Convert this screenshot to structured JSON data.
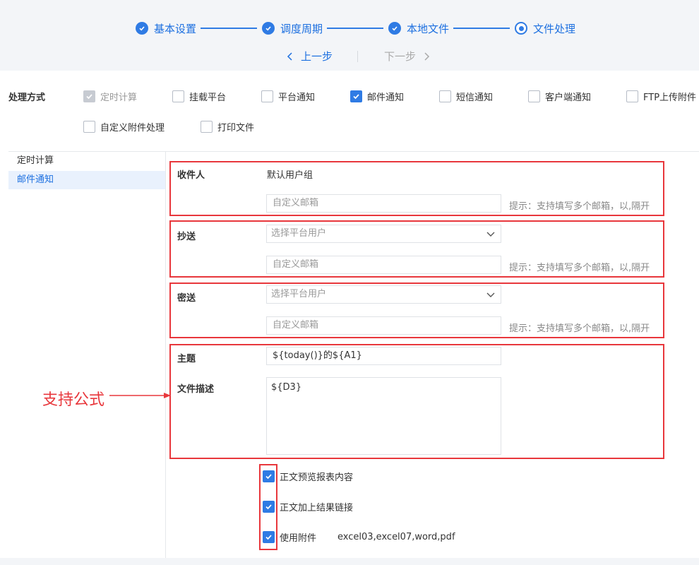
{
  "wizard": {
    "steps": [
      {
        "label": "基本设置",
        "state": "done"
      },
      {
        "label": "调度周期",
        "state": "done"
      },
      {
        "label": "本地文件",
        "state": "done"
      },
      {
        "label": "文件处理",
        "state": "current"
      }
    ],
    "prev_label": "上一步",
    "next_label": "下一步"
  },
  "method": {
    "label": "处理方式",
    "options": [
      {
        "label": "定时计算",
        "checked": true,
        "disabled": true
      },
      {
        "label": "挂载平台",
        "checked": false
      },
      {
        "label": "平台通知",
        "checked": false
      },
      {
        "label": "邮件通知",
        "checked": true
      },
      {
        "label": "短信通知",
        "checked": false
      },
      {
        "label": "客户端通知",
        "checked": false
      },
      {
        "label": "FTP上传附件",
        "checked": false
      },
      {
        "label": "自定义附件处理",
        "checked": false
      },
      {
        "label": "打印文件",
        "checked": false
      }
    ]
  },
  "sidebar": {
    "items": [
      {
        "label": "定时计算",
        "active": false
      },
      {
        "label": "邮件通知",
        "active": true
      }
    ]
  },
  "email": {
    "recipient": {
      "label": "收件人",
      "default_group": "默认用户组",
      "custom_placeholder": "自定义邮箱",
      "hint": "提示：支持填写多个邮箱，以,隔开"
    },
    "cc": {
      "label": "抄送",
      "select_placeholder": "选择平台用户",
      "custom_placeholder": "自定义邮箱",
      "hint": "提示：支持填写多个邮箱，以,隔开"
    },
    "bcc": {
      "label": "密送",
      "select_placeholder": "选择平台用户",
      "custom_placeholder": "自定义邮箱",
      "hint": "提示：支持填写多个邮箱，以,隔开"
    },
    "subject": {
      "label": "主题",
      "value": "${today()}的${A1}"
    },
    "description": {
      "label": "文件描述",
      "value": "${D3}"
    },
    "options": [
      {
        "label": "正文预览报表内容",
        "checked": true
      },
      {
        "label": "正文加上结果链接",
        "checked": true
      },
      {
        "label": "使用附件",
        "checked": true
      }
    ],
    "attachment_types": "excel03,excel07,word,pdf"
  },
  "annotation": {
    "text": "支持公式"
  },
  "colors": {
    "accent": "#2f7be4",
    "highlight": "#e8373c"
  },
  "icons": [
    "check-circle-icon",
    "radio-current-icon",
    "chevron-left-icon",
    "chevron-right-icon",
    "checkbox-icon",
    "chevron-down-icon",
    "arrow-icon"
  ]
}
